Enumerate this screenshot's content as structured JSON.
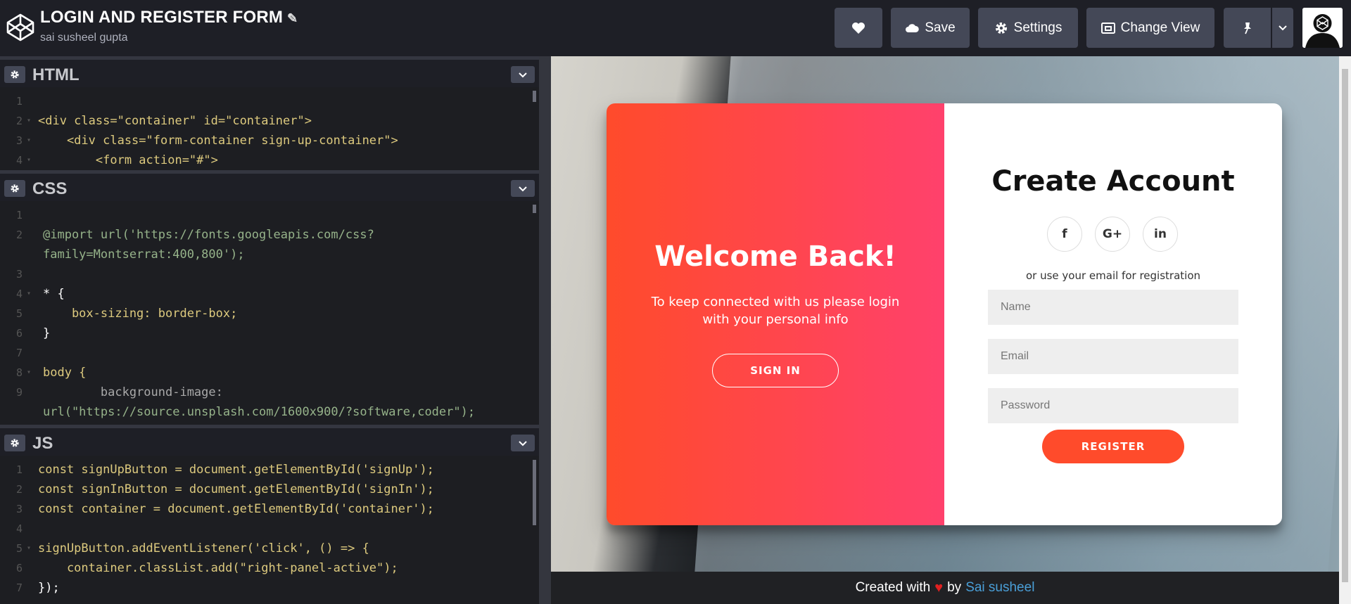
{
  "header": {
    "title": "LOGIN AND REGISTER FORM",
    "title_edit_glyph": "✎",
    "author": "sai susheel gupta",
    "buttons": {
      "save": "Save",
      "settings": "Settings",
      "change_view": "Change View"
    }
  },
  "editors": {
    "html": {
      "title": "HTML",
      "lines": [
        {
          "n": "1",
          "text": ""
        },
        {
          "n": "2",
          "text": "<div class=\"container\" id=\"container\">"
        },
        {
          "n": "3",
          "text": "    <div class=\"form-container sign-up-container\">"
        },
        {
          "n": "4",
          "text": "        <form action=\"#\">"
        }
      ]
    },
    "css": {
      "title": "CSS",
      "lines": [
        {
          "n": "1",
          "text": ""
        },
        {
          "n": "2",
          "text": "@import url('https://fonts.googleapis.com/css?"
        },
        {
          "n": "",
          "text": "family=Montserrat:400,800');"
        },
        {
          "n": "3",
          "text": ""
        },
        {
          "n": "4",
          "text": "* {"
        },
        {
          "n": "5",
          "text": "    box-sizing: border-box;"
        },
        {
          "n": "6",
          "text": "}"
        },
        {
          "n": "7",
          "text": ""
        },
        {
          "n": "8",
          "text": "body {"
        },
        {
          "n": "9",
          "text": "        background-image:"
        },
        {
          "n": "",
          "text": "url(\"https://source.unsplash.com/1600x900/?software,coder\");"
        }
      ]
    },
    "js": {
      "title": "JS",
      "lines": [
        {
          "n": "1",
          "text": "const signUpButton = document.getElementById('signUp');"
        },
        {
          "n": "2",
          "text": "const signInButton = document.getElementById('signIn');"
        },
        {
          "n": "3",
          "text": "const container = document.getElementById('container');"
        },
        {
          "n": "4",
          "text": ""
        },
        {
          "n": "5",
          "text": "signUpButton.addEventListener('click', () => {"
        },
        {
          "n": "6",
          "text": "    container.classList.add(\"right-panel-active\");"
        },
        {
          "n": "7",
          "text": "});"
        }
      ]
    }
  },
  "preview": {
    "overlay": {
      "title": "Welcome Back!",
      "text": "To keep connected with us please login with your personal info",
      "signin_label": "SIGN IN"
    },
    "form": {
      "title": "Create Account",
      "social": {
        "facebook": "f",
        "google": "G+",
        "linkedin": "in"
      },
      "or_text": "or use your email for registration",
      "name_placeholder": "Name",
      "email_placeholder": "Email",
      "password_placeholder": "Password",
      "register_label": "REGISTER"
    },
    "footer": {
      "created_with": "Created with",
      "heart": "♥",
      "by": "by",
      "author_link": "Sai susheel"
    }
  },
  "colors": {
    "accent_start": "#ff4b2b",
    "accent_end": "#ff416c",
    "link": "#4a9fd8"
  }
}
